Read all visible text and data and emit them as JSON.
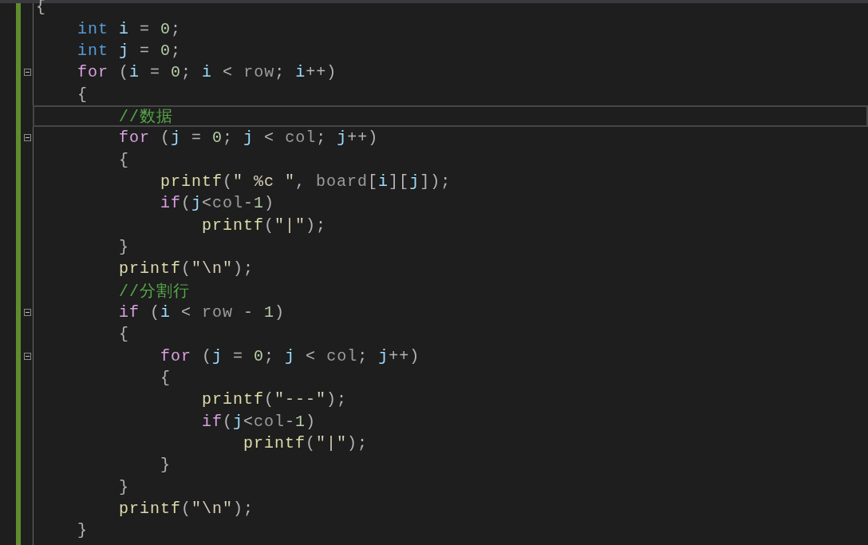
{
  "editor": {
    "lines": [
      {
        "current": false,
        "tokens": [
          {
            "kind": "op",
            "text": "{"
          }
        ],
        "children": [
          {
            "current": false,
            "tokens": [
              {
                "kind": "kw",
                "text": "int"
              },
              {
                "kind": "var",
                "text": " i"
              },
              {
                "kind": "op",
                "text": " ="
              },
              {
                "kind": "num",
                "text": " 0"
              },
              {
                "kind": "op",
                "text": ";"
              }
            ]
          },
          {
            "current": false,
            "tokens": [
              {
                "kind": "kw",
                "text": "int"
              },
              {
                "kind": "var",
                "text": " j"
              },
              {
                "kind": "op",
                "text": " ="
              },
              {
                "kind": "num",
                "text": " 0"
              },
              {
                "kind": "op",
                "text": ";"
              }
            ]
          },
          {
            "current": false,
            "expanded": true,
            "tokens": [
              {
                "kind": "ctrl",
                "text": "for"
              },
              {
                "kind": "op",
                "text": " ("
              },
              {
                "kind": "var",
                "text": "i"
              },
              {
                "kind": "op",
                "text": " ="
              },
              {
                "kind": "num",
                "text": " 0"
              },
              {
                "kind": "op",
                "text": ";"
              },
              {
                "kind": "var",
                "text": " i"
              },
              {
                "kind": "op",
                "text": " <"
              },
              {
                "kind": "param",
                "text": " row"
              },
              {
                "kind": "op",
                "text": ";"
              },
              {
                "kind": "var",
                "text": " i"
              },
              {
                "kind": "op",
                "text": "++)"
              }
            ]
          },
          {
            "current": false,
            "tokens": [
              {
                "kind": "op",
                "text": "{"
              }
            ],
            "children": [
              {
                "current": true,
                "tokens": [
                  {
                    "kind": "cm",
                    "text": "//数据"
                  }
                ]
              },
              {
                "current": false,
                "expanded": true,
                "tokens": [
                  {
                    "kind": "ctrl",
                    "text": "for"
                  },
                  {
                    "kind": "op",
                    "text": " ("
                  },
                  {
                    "kind": "var",
                    "text": "j"
                  },
                  {
                    "kind": "op",
                    "text": " ="
                  },
                  {
                    "kind": "num",
                    "text": " 0"
                  },
                  {
                    "kind": "op",
                    "text": ";"
                  },
                  {
                    "kind": "var",
                    "text": " j"
                  },
                  {
                    "kind": "op",
                    "text": " <"
                  },
                  {
                    "kind": "param",
                    "text": " col"
                  },
                  {
                    "kind": "op",
                    "text": ";"
                  },
                  {
                    "kind": "var",
                    "text": " j"
                  },
                  {
                    "kind": "op",
                    "text": "++)"
                  }
                ]
              },
              {
                "current": false,
                "tokens": [
                  {
                    "kind": "op",
                    "text": "{"
                  }
                ],
                "children": [
                  {
                    "current": false,
                    "tokens": [
                      {
                        "kind": "fn",
                        "text": "printf"
                      },
                      {
                        "kind": "op",
                        "text": "("
                      },
                      {
                        "kind": "str",
                        "text": "\" %c \""
                      },
                      {
                        "kind": "op",
                        "text": ","
                      },
                      {
                        "kind": "param",
                        "text": " board"
                      },
                      {
                        "kind": "op",
                        "text": "["
                      },
                      {
                        "kind": "var",
                        "text": "i"
                      },
                      {
                        "kind": "op",
                        "text": "]["
                      },
                      {
                        "kind": "var",
                        "text": "j"
                      },
                      {
                        "kind": "op",
                        "text": "]);"
                      }
                    ]
                  },
                  {
                    "current": false,
                    "tokens": [
                      {
                        "kind": "ctrl",
                        "text": "if"
                      },
                      {
                        "kind": "op",
                        "text": "("
                      },
                      {
                        "kind": "var",
                        "text": "j"
                      },
                      {
                        "kind": "op",
                        "text": "<"
                      },
                      {
                        "kind": "param",
                        "text": "col"
                      },
                      {
                        "kind": "op",
                        "text": "-"
                      },
                      {
                        "kind": "num",
                        "text": "1"
                      },
                      {
                        "kind": "op",
                        "text": ")"
                      }
                    ],
                    "children": [
                      {
                        "current": false,
                        "tokens": [
                          {
                            "kind": "fn",
                            "text": "printf"
                          },
                          {
                            "kind": "op",
                            "text": "("
                          },
                          {
                            "kind": "str",
                            "text": "\"|\""
                          },
                          {
                            "kind": "op",
                            "text": ");"
                          }
                        ]
                      }
                    ]
                  }
                ]
              },
              {
                "current": false,
                "tokens": [
                  {
                    "kind": "op",
                    "text": "}"
                  }
                ]
              },
              {
                "current": false,
                "tokens": [
                  {
                    "kind": "fn",
                    "text": "printf"
                  },
                  {
                    "kind": "op",
                    "text": "("
                  },
                  {
                    "kind": "str",
                    "text": "\"\\n\""
                  },
                  {
                    "kind": "op",
                    "text": ");"
                  }
                ]
              },
              {
                "current": false,
                "tokens": [
                  {
                    "kind": "cm",
                    "text": "//分割行"
                  }
                ]
              },
              {
                "current": false,
                "expanded": true,
                "tokens": [
                  {
                    "kind": "ctrl",
                    "text": "if"
                  },
                  {
                    "kind": "op",
                    "text": " ("
                  },
                  {
                    "kind": "var",
                    "text": "i"
                  },
                  {
                    "kind": "op",
                    "text": " <"
                  },
                  {
                    "kind": "param",
                    "text": " row"
                  },
                  {
                    "kind": "op",
                    "text": " -"
                  },
                  {
                    "kind": "num",
                    "text": " 1"
                  },
                  {
                    "kind": "op",
                    "text": ")"
                  }
                ]
              },
              {
                "current": false,
                "tokens": [
                  {
                    "kind": "op",
                    "text": "{"
                  }
                ],
                "children": [
                  {
                    "current": false,
                    "expanded": true,
                    "tokens": [
                      {
                        "kind": "ctrl",
                        "text": "for"
                      },
                      {
                        "kind": "op",
                        "text": " ("
                      },
                      {
                        "kind": "var",
                        "text": "j"
                      },
                      {
                        "kind": "op",
                        "text": " ="
                      },
                      {
                        "kind": "num",
                        "text": " 0"
                      },
                      {
                        "kind": "op",
                        "text": ";"
                      },
                      {
                        "kind": "var",
                        "text": " j"
                      },
                      {
                        "kind": "op",
                        "text": " <"
                      },
                      {
                        "kind": "param",
                        "text": " col"
                      },
                      {
                        "kind": "op",
                        "text": ";"
                      },
                      {
                        "kind": "var",
                        "text": " j"
                      },
                      {
                        "kind": "op",
                        "text": "++)"
                      }
                    ]
                  },
                  {
                    "current": false,
                    "tokens": [
                      {
                        "kind": "op",
                        "text": "{"
                      }
                    ],
                    "children": [
                      {
                        "current": false,
                        "tokens": [
                          {
                            "kind": "fn",
                            "text": "printf"
                          },
                          {
                            "kind": "op",
                            "text": "("
                          },
                          {
                            "kind": "str",
                            "text": "\"---\""
                          },
                          {
                            "kind": "op",
                            "text": ");"
                          }
                        ]
                      },
                      {
                        "current": false,
                        "tokens": [
                          {
                            "kind": "ctrl",
                            "text": "if"
                          },
                          {
                            "kind": "op",
                            "text": "("
                          },
                          {
                            "kind": "var",
                            "text": "j"
                          },
                          {
                            "kind": "op",
                            "text": "<"
                          },
                          {
                            "kind": "param",
                            "text": "col"
                          },
                          {
                            "kind": "op",
                            "text": "-"
                          },
                          {
                            "kind": "num",
                            "text": "1"
                          },
                          {
                            "kind": "op",
                            "text": ")"
                          }
                        ],
                        "children": [
                          {
                            "current": false,
                            "tokens": [
                              {
                                "kind": "fn",
                                "text": "printf"
                              },
                              {
                                "kind": "op",
                                "text": "("
                              },
                              {
                                "kind": "str",
                                "text": "\"|\""
                              },
                              {
                                "kind": "op",
                                "text": ");"
                              }
                            ]
                          }
                        ]
                      }
                    ]
                  },
                  {
                    "current": false,
                    "tokens": [
                      {
                        "kind": "op",
                        "text": "}"
                      }
                    ]
                  }
                ]
              },
              {
                "current": false,
                "tokens": [
                  {
                    "kind": "op",
                    "text": "}"
                  }
                ]
              },
              {
                "current": false,
                "tokens": [
                  {
                    "kind": "fn",
                    "text": "printf"
                  },
                  {
                    "kind": "op",
                    "text": "("
                  },
                  {
                    "kind": "str",
                    "text": "\"\\n\""
                  },
                  {
                    "kind": "op",
                    "text": ");"
                  }
                ]
              }
            ]
          },
          {
            "current": false,
            "tokens": [
              {
                "kind": "op",
                "text": "}"
              }
            ]
          }
        ]
      }
    ]
  }
}
